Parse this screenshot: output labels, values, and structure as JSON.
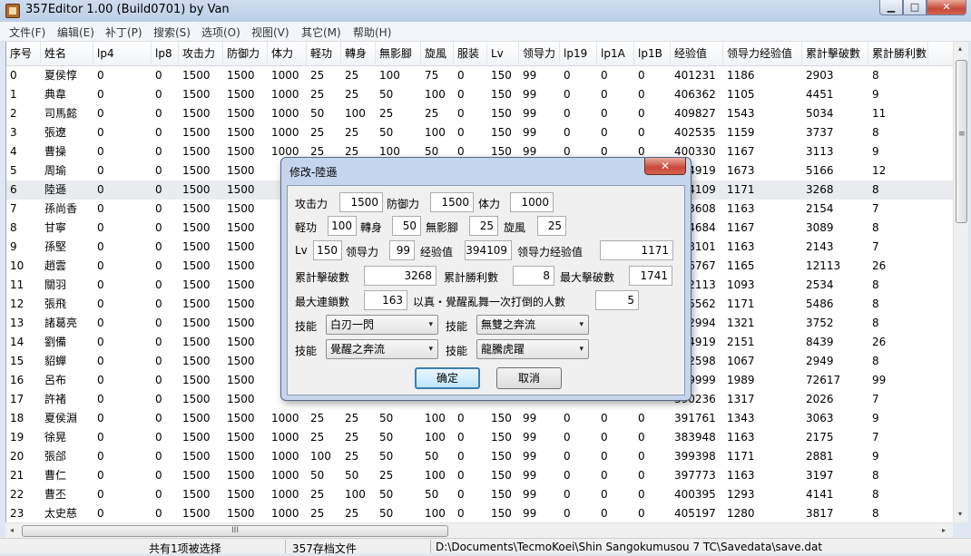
{
  "window": {
    "title": "357Editor 1.00 (Build0701) by Van",
    "min_glyph": "▁",
    "max_glyph": "□",
    "close_glyph": "✕"
  },
  "menu": [
    "文件(F)",
    "编辑(E)",
    "补丁(P)",
    "搜索(S)",
    "选项(O)",
    "视图(V)",
    "其它(M)",
    "帮助(H)"
  ],
  "table": {
    "columns": [
      "序号",
      "姓名",
      "lp4",
      "lp8",
      "攻击力",
      "防御力",
      "体力",
      "軽功",
      "轉身",
      "無影腳",
      "旋風",
      "服装",
      "Lv",
      "领导力",
      "lp19",
      "lp1A",
      "lp1B",
      "经验值",
      "领导力经验值",
      "累計擊破數",
      "累計勝利數"
    ],
    "selected_index": 6,
    "rows": [
      [
        "0",
        "夏侯惇",
        "0",
        "0",
        "1500",
        "1500",
        "1000",
        "25",
        "25",
        "100",
        "75",
        "0",
        "150",
        "99",
        "0",
        "0",
        "0",
        "401231",
        "1186",
        "2903",
        "8"
      ],
      [
        "1",
        "典韋",
        "0",
        "0",
        "1500",
        "1500",
        "1000",
        "25",
        "25",
        "50",
        "100",
        "0",
        "150",
        "99",
        "0",
        "0",
        "0",
        "406362",
        "1105",
        "4451",
        "9"
      ],
      [
        "2",
        "司馬懿",
        "0",
        "0",
        "1500",
        "1500",
        "1000",
        "50",
        "100",
        "25",
        "25",
        "0",
        "150",
        "99",
        "0",
        "0",
        "0",
        "409827",
        "1543",
        "5034",
        "11"
      ],
      [
        "3",
        "張遼",
        "0",
        "0",
        "1500",
        "1500",
        "1000",
        "25",
        "25",
        "50",
        "100",
        "0",
        "150",
        "99",
        "0",
        "0",
        "0",
        "402535",
        "1159",
        "3737",
        "8"
      ],
      [
        "4",
        "曹操",
        "0",
        "0",
        "1500",
        "1500",
        "1000",
        "25",
        "25",
        "100",
        "50",
        "0",
        "150",
        "99",
        "0",
        "0",
        "0",
        "400330",
        "1167",
        "3113",
        "9"
      ],
      [
        "5",
        "周瑜",
        "0",
        "0",
        "1500",
        "1500",
        "",
        "",
        "",
        "",
        "",
        "",
        "",
        "",
        "",
        "",
        "",
        "424919",
        "1673",
        "5166",
        "12"
      ],
      [
        "6",
        "陸遜",
        "0",
        "0",
        "1500",
        "1500",
        "",
        "",
        "",
        "",
        "",
        "",
        "",
        "",
        "",
        "",
        "",
        "394109",
        "1171",
        "3268",
        "8"
      ],
      [
        "7",
        "孫尚香",
        "0",
        "0",
        "1500",
        "1500",
        "",
        "",
        "",
        "",
        "",
        "",
        "",
        "",
        "",
        "",
        "",
        "383608",
        "1163",
        "2154",
        "7"
      ],
      [
        "8",
        "甘寧",
        "0",
        "0",
        "1500",
        "1500",
        "",
        "",
        "",
        "",
        "",
        "",
        "",
        "",
        "",
        "",
        "",
        "394684",
        "1167",
        "3089",
        "8"
      ],
      [
        "9",
        "孫堅",
        "0",
        "0",
        "1500",
        "1500",
        "",
        "",
        "",
        "",
        "",
        "",
        "",
        "",
        "",
        "",
        "",
        "388101",
        "1163",
        "2143",
        "7"
      ],
      [
        "10",
        "趙雲",
        "0",
        "0",
        "1500",
        "1500",
        "",
        "",
        "",
        "",
        "",
        "",
        "",
        "",
        "",
        "",
        "",
        "556767",
        "1165",
        "12113",
        "26"
      ],
      [
        "11",
        "關羽",
        "0",
        "0",
        "1500",
        "1500",
        "",
        "",
        "",
        "",
        "",
        "",
        "",
        "",
        "",
        "",
        "",
        "392113",
        "1093",
        "2534",
        "8"
      ],
      [
        "12",
        "張飛",
        "0",
        "0",
        "1500",
        "1500",
        "",
        "",
        "",
        "",
        "",
        "",
        "",
        "",
        "",
        "",
        "",
        "405562",
        "1171",
        "5486",
        "8"
      ],
      [
        "13",
        "諸葛亮",
        "0",
        "0",
        "1500",
        "1500",
        "",
        "",
        "",
        "",
        "",
        "",
        "",
        "",
        "",
        "",
        "",
        "402994",
        "1321",
        "3752",
        "8"
      ],
      [
        "14",
        "劉備",
        "0",
        "0",
        "1500",
        "1500",
        "",
        "",
        "",
        "",
        "",
        "",
        "",
        "",
        "",
        "",
        "",
        "484919",
        "2151",
        "8439",
        "26"
      ],
      [
        "15",
        "貂蟬",
        "0",
        "0",
        "1500",
        "1500",
        "",
        "",
        "",
        "",
        "",
        "",
        "",
        "",
        "",
        "",
        "",
        "462598",
        "1067",
        "2949",
        "8"
      ],
      [
        "16",
        "呂布",
        "0",
        "0",
        "1500",
        "1500",
        "",
        "",
        "",
        "",
        "",
        "",
        "",
        "",
        "",
        "",
        "",
        "999999",
        "1989",
        "72617",
        "99"
      ],
      [
        "17",
        "許褚",
        "0",
        "0",
        "1500",
        "1500",
        "",
        "",
        "",
        "",
        "",
        "",
        "",
        "",
        "",
        "",
        "",
        "390236",
        "1317",
        "2026",
        "7"
      ],
      [
        "18",
        "夏侯淵",
        "0",
        "0",
        "1500",
        "1500",
        "1000",
        "25",
        "25",
        "50",
        "100",
        "0",
        "150",
        "99",
        "0",
        "0",
        "0",
        "391761",
        "1343",
        "3063",
        "9"
      ],
      [
        "19",
        "徐晃",
        "0",
        "0",
        "1500",
        "1500",
        "1000",
        "25",
        "25",
        "50",
        "100",
        "0",
        "150",
        "99",
        "0",
        "0",
        "0",
        "383948",
        "1163",
        "2175",
        "7"
      ],
      [
        "20",
        "張郃",
        "0",
        "0",
        "1500",
        "1500",
        "1000",
        "100",
        "25",
        "50",
        "50",
        "0",
        "150",
        "99",
        "0",
        "0",
        "0",
        "399398",
        "1171",
        "2881",
        "9"
      ],
      [
        "21",
        "曹仁",
        "0",
        "0",
        "1500",
        "1500",
        "1000",
        "50",
        "50",
        "25",
        "100",
        "0",
        "150",
        "99",
        "0",
        "0",
        "0",
        "397773",
        "1163",
        "3197",
        "8"
      ],
      [
        "22",
        "曹丕",
        "0",
        "0",
        "1500",
        "1500",
        "1000",
        "25",
        "100",
        "50",
        "50",
        "0",
        "150",
        "99",
        "0",
        "0",
        "0",
        "400395",
        "1293",
        "4141",
        "8"
      ],
      [
        "23",
        "太史慈",
        "0",
        "0",
        "1500",
        "1500",
        "1000",
        "25",
        "25",
        "50",
        "100",
        "0",
        "150",
        "99",
        "0",
        "0",
        "0",
        "405197",
        "1280",
        "3817",
        "8"
      ]
    ]
  },
  "scroll": {
    "h_grip": "III",
    "left": "◂",
    "right": "▸",
    "up": "▴",
    "down": "▾"
  },
  "status": {
    "selection": "共有1项被选择",
    "filetype": "357存档文件",
    "path": "D:\\Documents\\TecmoKoei\\Shin Sangokumusou 7 TC\\Savedata\\save.dat"
  },
  "dialog": {
    "title": "修改-陸遜",
    "close_glyph": "✕",
    "attack_label": "攻击力",
    "attack": "1500",
    "defense_label": "防御力",
    "defense": "1500",
    "hp_label": "体力",
    "hp": "1000",
    "light_label": "軽功",
    "light": "100",
    "turn_label": "轉身",
    "turn": "50",
    "shadow_label": "無影腳",
    "shadow": "25",
    "whirl_label": "旋風",
    "whirl": "25",
    "lv_label": "Lv",
    "lv": "150",
    "lead_label": "领导力",
    "lead": "99",
    "exp_label": "经验值",
    "exp": "394109",
    "leadexp_label": "领导力经验值",
    "leadexp": "1171",
    "kills_label": "累計擊破數",
    "kills": "3268",
    "wins_label": "累計勝利數",
    "wins": "8",
    "maxkills_label": "最大擊破數",
    "maxkills": "1741",
    "combo_label": "最大連鎖數",
    "combo": "163",
    "musou_label": "以真・覺醒亂舞一次打倒的人數",
    "musou": "5",
    "skill_label": "技能",
    "skill1": "白刃一閃",
    "skill2": "無雙之奔流",
    "skill3": "覺醒之奔流",
    "skill4": "龍騰虎躍",
    "ok": "确定",
    "cancel": "取消",
    "dropdown_glyph": "▾"
  }
}
